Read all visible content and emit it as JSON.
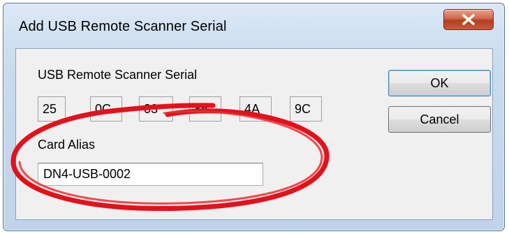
{
  "window": {
    "title": "Add USB Remote Scanner Serial",
    "close_glyph": "x"
  },
  "serial": {
    "label": "USB Remote Scanner Serial",
    "bytes": [
      "25",
      "0C",
      "03",
      "86",
      "4A",
      "9C"
    ]
  },
  "alias": {
    "label": "Card Alias",
    "value": "DN4-USB-0002"
  },
  "buttons": {
    "ok": "OK",
    "cancel": "Cancel"
  },
  "annotation": {
    "shape": "ellipse",
    "color": "#e3111b",
    "target": "card-alias-field"
  },
  "colors": {
    "close_button": "#c7452b",
    "title_bar": "#c9dbee",
    "client_area": "#f0f0f0"
  }
}
